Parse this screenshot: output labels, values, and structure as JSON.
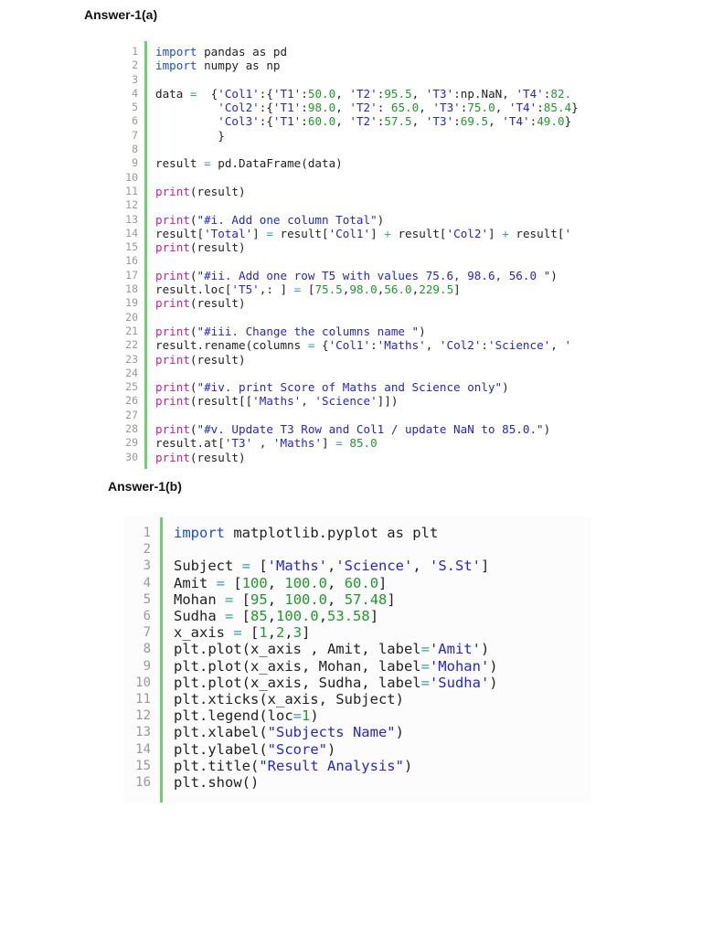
{
  "headings": {
    "a": "Answer-1(a)",
    "b": "Answer-1(b)"
  },
  "code_a": [
    [
      [
        "k",
        "import"
      ],
      [
        "p",
        " pandas as pd"
      ]
    ],
    [
      [
        "k",
        "import"
      ],
      [
        "p",
        " numpy as np"
      ]
    ],
    [],
    [
      [
        "p",
        "data "
      ],
      [
        "o",
        "="
      ],
      [
        "p",
        "  {"
      ],
      [
        "s",
        "'Col1'"
      ],
      [
        "p",
        ":{"
      ],
      [
        "s",
        "'T1'"
      ],
      [
        "p",
        ":"
      ],
      [
        "n",
        "50.0"
      ],
      [
        "p",
        ", "
      ],
      [
        "s",
        "'T2'"
      ],
      [
        "p",
        ":"
      ],
      [
        "n",
        "95.5"
      ],
      [
        "p",
        ", "
      ],
      [
        "s",
        "'T3'"
      ],
      [
        "p",
        ":np.NaN, "
      ],
      [
        "s",
        "'T4'"
      ],
      [
        "p",
        ":"
      ],
      [
        "n",
        "82."
      ]
    ],
    [
      [
        "p",
        "         "
      ],
      [
        "s",
        "'Col2'"
      ],
      [
        "p",
        ":{"
      ],
      [
        "s",
        "'T1'"
      ],
      [
        "p",
        ":"
      ],
      [
        "n",
        "98.0"
      ],
      [
        "p",
        ", "
      ],
      [
        "s",
        "'T2'"
      ],
      [
        "p",
        ": "
      ],
      [
        "n",
        "65.0"
      ],
      [
        "p",
        ", "
      ],
      [
        "s",
        "'T3'"
      ],
      [
        "p",
        ":"
      ],
      [
        "n",
        "75.0"
      ],
      [
        "p",
        ", "
      ],
      [
        "s",
        "'T4'"
      ],
      [
        "p",
        ":"
      ],
      [
        "n",
        "85.4"
      ],
      [
        "p",
        "}"
      ]
    ],
    [
      [
        "p",
        "         "
      ],
      [
        "s",
        "'Col3'"
      ],
      [
        "p",
        ":{"
      ],
      [
        "s",
        "'T1'"
      ],
      [
        "p",
        ":"
      ],
      [
        "n",
        "60.0"
      ],
      [
        "p",
        ", "
      ],
      [
        "s",
        "'T2'"
      ],
      [
        "p",
        ":"
      ],
      [
        "n",
        "57.5"
      ],
      [
        "p",
        ", "
      ],
      [
        "s",
        "'T3'"
      ],
      [
        "p",
        ":"
      ],
      [
        "n",
        "69.5"
      ],
      [
        "p",
        ", "
      ],
      [
        "s",
        "'T4'"
      ],
      [
        "p",
        ":"
      ],
      [
        "n",
        "49.0"
      ],
      [
        "p",
        "}"
      ]
    ],
    [
      [
        "p",
        "         }"
      ]
    ],
    [],
    [
      [
        "p",
        "result "
      ],
      [
        "o",
        "="
      ],
      [
        "p",
        " pd.DataFrame(data)"
      ]
    ],
    [],
    [
      [
        "f",
        "print"
      ],
      [
        "p",
        "(result)"
      ]
    ],
    [],
    [
      [
        "f",
        "print"
      ],
      [
        "p",
        "("
      ],
      [
        "s",
        "\"#i. Add one column Total\""
      ],
      [
        "p",
        ")"
      ]
    ],
    [
      [
        "p",
        "result["
      ],
      [
        "s",
        "'Total'"
      ],
      [
        "p",
        "] "
      ],
      [
        "o",
        "="
      ],
      [
        "p",
        " result["
      ],
      [
        "s",
        "'Col1'"
      ],
      [
        "p",
        "] "
      ],
      [
        "o",
        "+"
      ],
      [
        "p",
        " result["
      ],
      [
        "s",
        "'Col2'"
      ],
      [
        "p",
        "] "
      ],
      [
        "o",
        "+"
      ],
      [
        "p",
        " result["
      ],
      [
        "s",
        "'"
      ]
    ],
    [
      [
        "f",
        "print"
      ],
      [
        "p",
        "(result)"
      ]
    ],
    [],
    [
      [
        "f",
        "print"
      ],
      [
        "p",
        "("
      ],
      [
        "s",
        "\"#ii. Add one row T5 with values 75.6, 98.6, 56.0 \""
      ],
      [
        "p",
        ")"
      ]
    ],
    [
      [
        "p",
        "result.loc["
      ],
      [
        "s",
        "'T5'"
      ],
      [
        "p",
        ",: ] "
      ],
      [
        "o",
        "="
      ],
      [
        "p",
        " ["
      ],
      [
        "n",
        "75.5"
      ],
      [
        "p",
        ","
      ],
      [
        "n",
        "98.0"
      ],
      [
        "p",
        ","
      ],
      [
        "n",
        "56.0"
      ],
      [
        "p",
        ","
      ],
      [
        "n",
        "229.5"
      ],
      [
        "p",
        "]"
      ]
    ],
    [
      [
        "f",
        "print"
      ],
      [
        "p",
        "(result)"
      ]
    ],
    [],
    [
      [
        "f",
        "print"
      ],
      [
        "p",
        "("
      ],
      [
        "s",
        "\"#iii. Change the columns name \""
      ],
      [
        "p",
        ")"
      ]
    ],
    [
      [
        "p",
        "result.rename(columns "
      ],
      [
        "o",
        "="
      ],
      [
        "p",
        " {"
      ],
      [
        "s",
        "'Col1'"
      ],
      [
        "p",
        ":"
      ],
      [
        "s",
        "'Maths'"
      ],
      [
        "p",
        ", "
      ],
      [
        "s",
        "'Col2'"
      ],
      [
        "p",
        ":"
      ],
      [
        "s",
        "'Science'"
      ],
      [
        "p",
        ", "
      ],
      [
        "s",
        "'"
      ]
    ],
    [
      [
        "f",
        "print"
      ],
      [
        "p",
        "(result)"
      ]
    ],
    [],
    [
      [
        "f",
        "print"
      ],
      [
        "p",
        "("
      ],
      [
        "s",
        "\"#iv. print Score of Maths and Science only\""
      ],
      [
        "p",
        ")"
      ]
    ],
    [
      [
        "f",
        "print"
      ],
      [
        "p",
        "(result[["
      ],
      [
        "s",
        "'Maths'"
      ],
      [
        "p",
        ", "
      ],
      [
        "s",
        "'Science'"
      ],
      [
        "p",
        "]])"
      ]
    ],
    [],
    [
      [
        "f",
        "print"
      ],
      [
        "p",
        "("
      ],
      [
        "s",
        "\"#v. Update T3 Row and Col1 / update NaN to 85.0.\""
      ],
      [
        "p",
        ")"
      ]
    ],
    [
      [
        "p",
        "result.at["
      ],
      [
        "s",
        "'T3'"
      ],
      [
        "p",
        " , "
      ],
      [
        "s",
        "'Maths'"
      ],
      [
        "p",
        "] "
      ],
      [
        "o",
        "="
      ],
      [
        "p",
        " "
      ],
      [
        "n",
        "85.0"
      ]
    ],
    [
      [
        "f",
        "print"
      ],
      [
        "p",
        "(result)"
      ]
    ]
  ],
  "code_b": [
    [
      [
        "k",
        "import"
      ],
      [
        "p",
        " matplotlib.pyplot as plt"
      ]
    ],
    [],
    [
      [
        "p",
        "Subject "
      ],
      [
        "o",
        "="
      ],
      [
        "p",
        " ["
      ],
      [
        "s",
        "'Maths'"
      ],
      [
        "p",
        ","
      ],
      [
        "s",
        "'Science'"
      ],
      [
        "p",
        ", "
      ],
      [
        "s",
        "'S.St'"
      ],
      [
        "p",
        "]"
      ]
    ],
    [
      [
        "p",
        "Amit "
      ],
      [
        "o",
        "="
      ],
      [
        "p",
        " ["
      ],
      [
        "n",
        "100"
      ],
      [
        "p",
        ", "
      ],
      [
        "n",
        "100.0"
      ],
      [
        "p",
        ", "
      ],
      [
        "n",
        "60.0"
      ],
      [
        "p",
        "]"
      ]
    ],
    [
      [
        "p",
        "Mohan "
      ],
      [
        "o",
        "="
      ],
      [
        "p",
        " ["
      ],
      [
        "n",
        "95"
      ],
      [
        "p",
        ", "
      ],
      [
        "n",
        "100.0"
      ],
      [
        "p",
        ", "
      ],
      [
        "n",
        "57.48"
      ],
      [
        "p",
        "]"
      ]
    ],
    [
      [
        "p",
        "Sudha "
      ],
      [
        "o",
        "="
      ],
      [
        "p",
        " ["
      ],
      [
        "n",
        "85"
      ],
      [
        "p",
        ","
      ],
      [
        "n",
        "100.0"
      ],
      [
        "p",
        ","
      ],
      [
        "n",
        "53.58"
      ],
      [
        "p",
        "]"
      ]
    ],
    [
      [
        "p",
        "x_axis "
      ],
      [
        "o",
        "="
      ],
      [
        "p",
        " ["
      ],
      [
        "n",
        "1"
      ],
      [
        "p",
        ","
      ],
      [
        "n",
        "2"
      ],
      [
        "p",
        ","
      ],
      [
        "n",
        "3"
      ],
      [
        "p",
        "]"
      ]
    ],
    [
      [
        "p",
        "plt.plot(x_axis , Amit, label"
      ],
      [
        "o",
        "="
      ],
      [
        "s",
        "'Amit'"
      ],
      [
        "p",
        ")"
      ]
    ],
    [
      [
        "p",
        "plt.plot(x_axis, Mohan, label"
      ],
      [
        "o",
        "="
      ],
      [
        "s",
        "'Mohan'"
      ],
      [
        "p",
        ")"
      ]
    ],
    [
      [
        "p",
        "plt.plot(x_axis, Sudha, label"
      ],
      [
        "o",
        "="
      ],
      [
        "s",
        "'Sudha'"
      ],
      [
        "p",
        ")"
      ]
    ],
    [
      [
        "p",
        "plt.xticks(x_axis, Subject)"
      ]
    ],
    [
      [
        "p",
        "plt.legend(loc"
      ],
      [
        "o",
        "="
      ],
      [
        "n",
        "1"
      ],
      [
        "p",
        ")"
      ]
    ],
    [
      [
        "p",
        "plt.xlabel("
      ],
      [
        "s",
        "\"Subjects Name\""
      ],
      [
        "p",
        ")"
      ]
    ],
    [
      [
        "p",
        "plt.ylabel("
      ],
      [
        "s",
        "\"Score\""
      ],
      [
        "p",
        ")"
      ]
    ],
    [
      [
        "p",
        "plt.title("
      ],
      [
        "s",
        "\"Result Analysis\""
      ],
      [
        "p",
        ")"
      ]
    ],
    [
      [
        "p",
        "plt.show()"
      ]
    ]
  ]
}
